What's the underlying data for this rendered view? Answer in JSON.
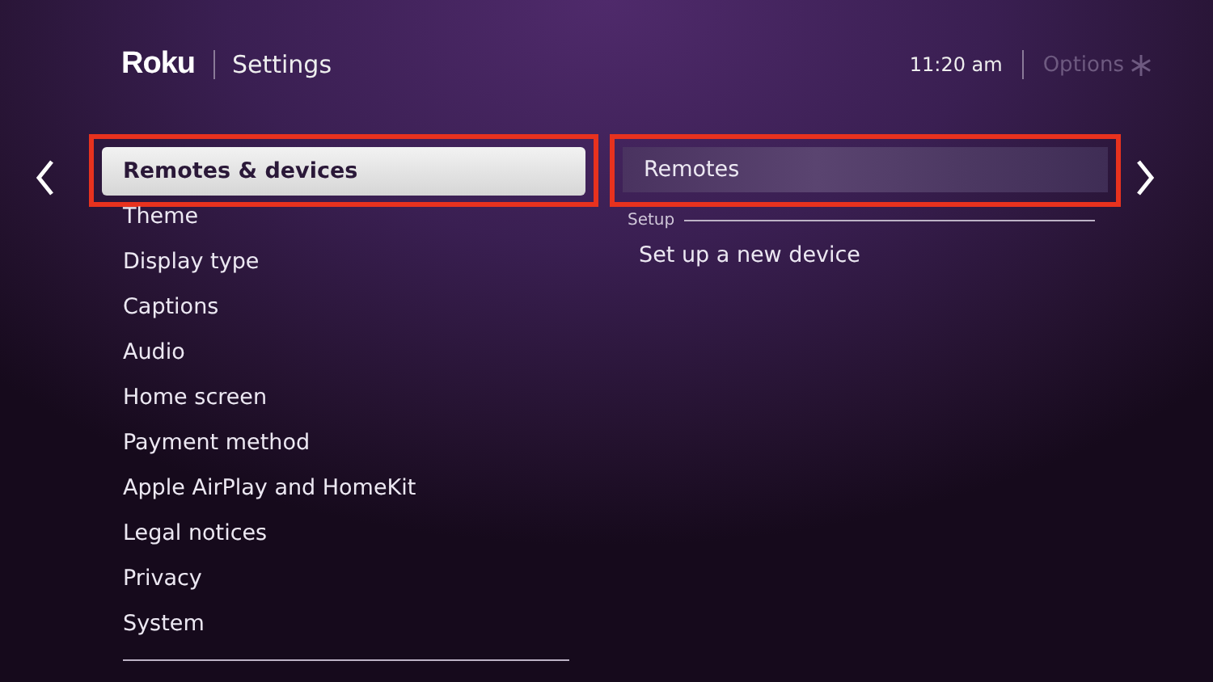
{
  "header": {
    "logo": "Roku",
    "title": "Settings",
    "time": "11:20 am",
    "options": "Options"
  },
  "menu": {
    "items": [
      {
        "label": "Remotes & devices",
        "selected": true,
        "highlighted": true
      },
      {
        "label": "Theme",
        "selected": false,
        "highlighted": false
      },
      {
        "label": "Display type",
        "selected": false,
        "highlighted": false
      },
      {
        "label": "Captions",
        "selected": false,
        "highlighted": false
      },
      {
        "label": "Audio",
        "selected": false,
        "highlighted": false
      },
      {
        "label": "Home screen",
        "selected": false,
        "highlighted": false
      },
      {
        "label": "Payment method",
        "selected": false,
        "highlighted": false
      },
      {
        "label": "Apple AirPlay and HomeKit",
        "selected": false,
        "highlighted": false
      },
      {
        "label": "Legal notices",
        "selected": false,
        "highlighted": false
      },
      {
        "label": "Privacy",
        "selected": false,
        "highlighted": false
      },
      {
        "label": "System",
        "selected": false,
        "highlighted": false
      }
    ]
  },
  "panel": {
    "items": [
      {
        "kind": "option",
        "label": "Remotes",
        "selected": true,
        "highlighted": true
      },
      {
        "kind": "section",
        "label": "Setup"
      },
      {
        "kind": "option",
        "label": "Set up a new device",
        "selected": false,
        "highlighted": false
      }
    ]
  }
}
